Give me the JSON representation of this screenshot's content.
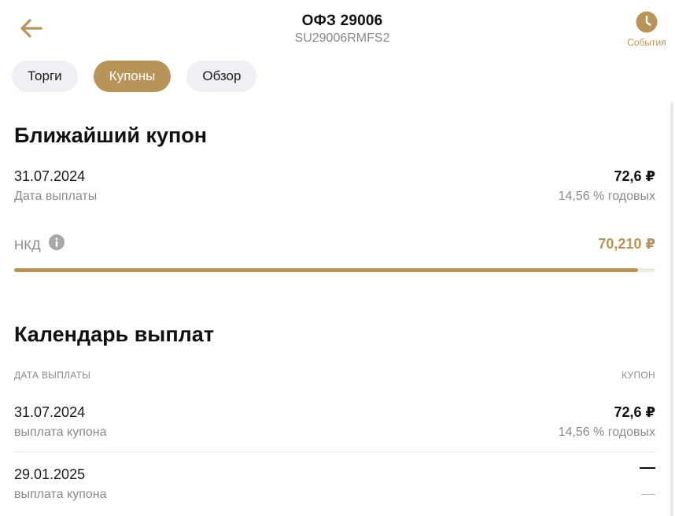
{
  "header": {
    "title": "ОФЗ 29006",
    "subtitle": "SU29006RMFS2",
    "events_label": "События",
    "back_icon": "arrow-left-icon",
    "events_icon": "clock-icon"
  },
  "tabs": [
    {
      "label": "Торги",
      "active": false
    },
    {
      "label": "Купоны",
      "active": true
    },
    {
      "label": "Обзор",
      "active": false
    }
  ],
  "nearest_coupon": {
    "section_title": "Ближайший купон",
    "date": "31.07.2024",
    "date_label": "Дата выплаты",
    "amount": "72,6 ₽",
    "yield": "14,56 % годовых",
    "nkd_label": "НКД",
    "nkd_value": "70,210 ₽",
    "nkd_progress": 0.973
  },
  "calendar": {
    "section_title": "Календарь выплат",
    "col_date": "ДАТА ВЫПЛАТЫ",
    "col_coupon": "КУПОН",
    "rows": [
      {
        "date": "31.07.2024",
        "type": "выплата купона",
        "amount": "72,6 ₽",
        "yield": "14,56 % годовых"
      },
      {
        "date": "29.01.2025",
        "type": "выплата купона",
        "amount": "—",
        "yield": "—"
      }
    ]
  },
  "colors": {
    "accent": "#b8935a",
    "tab_bg": "#eef0f3",
    "muted_text": "#8a8a8a"
  }
}
